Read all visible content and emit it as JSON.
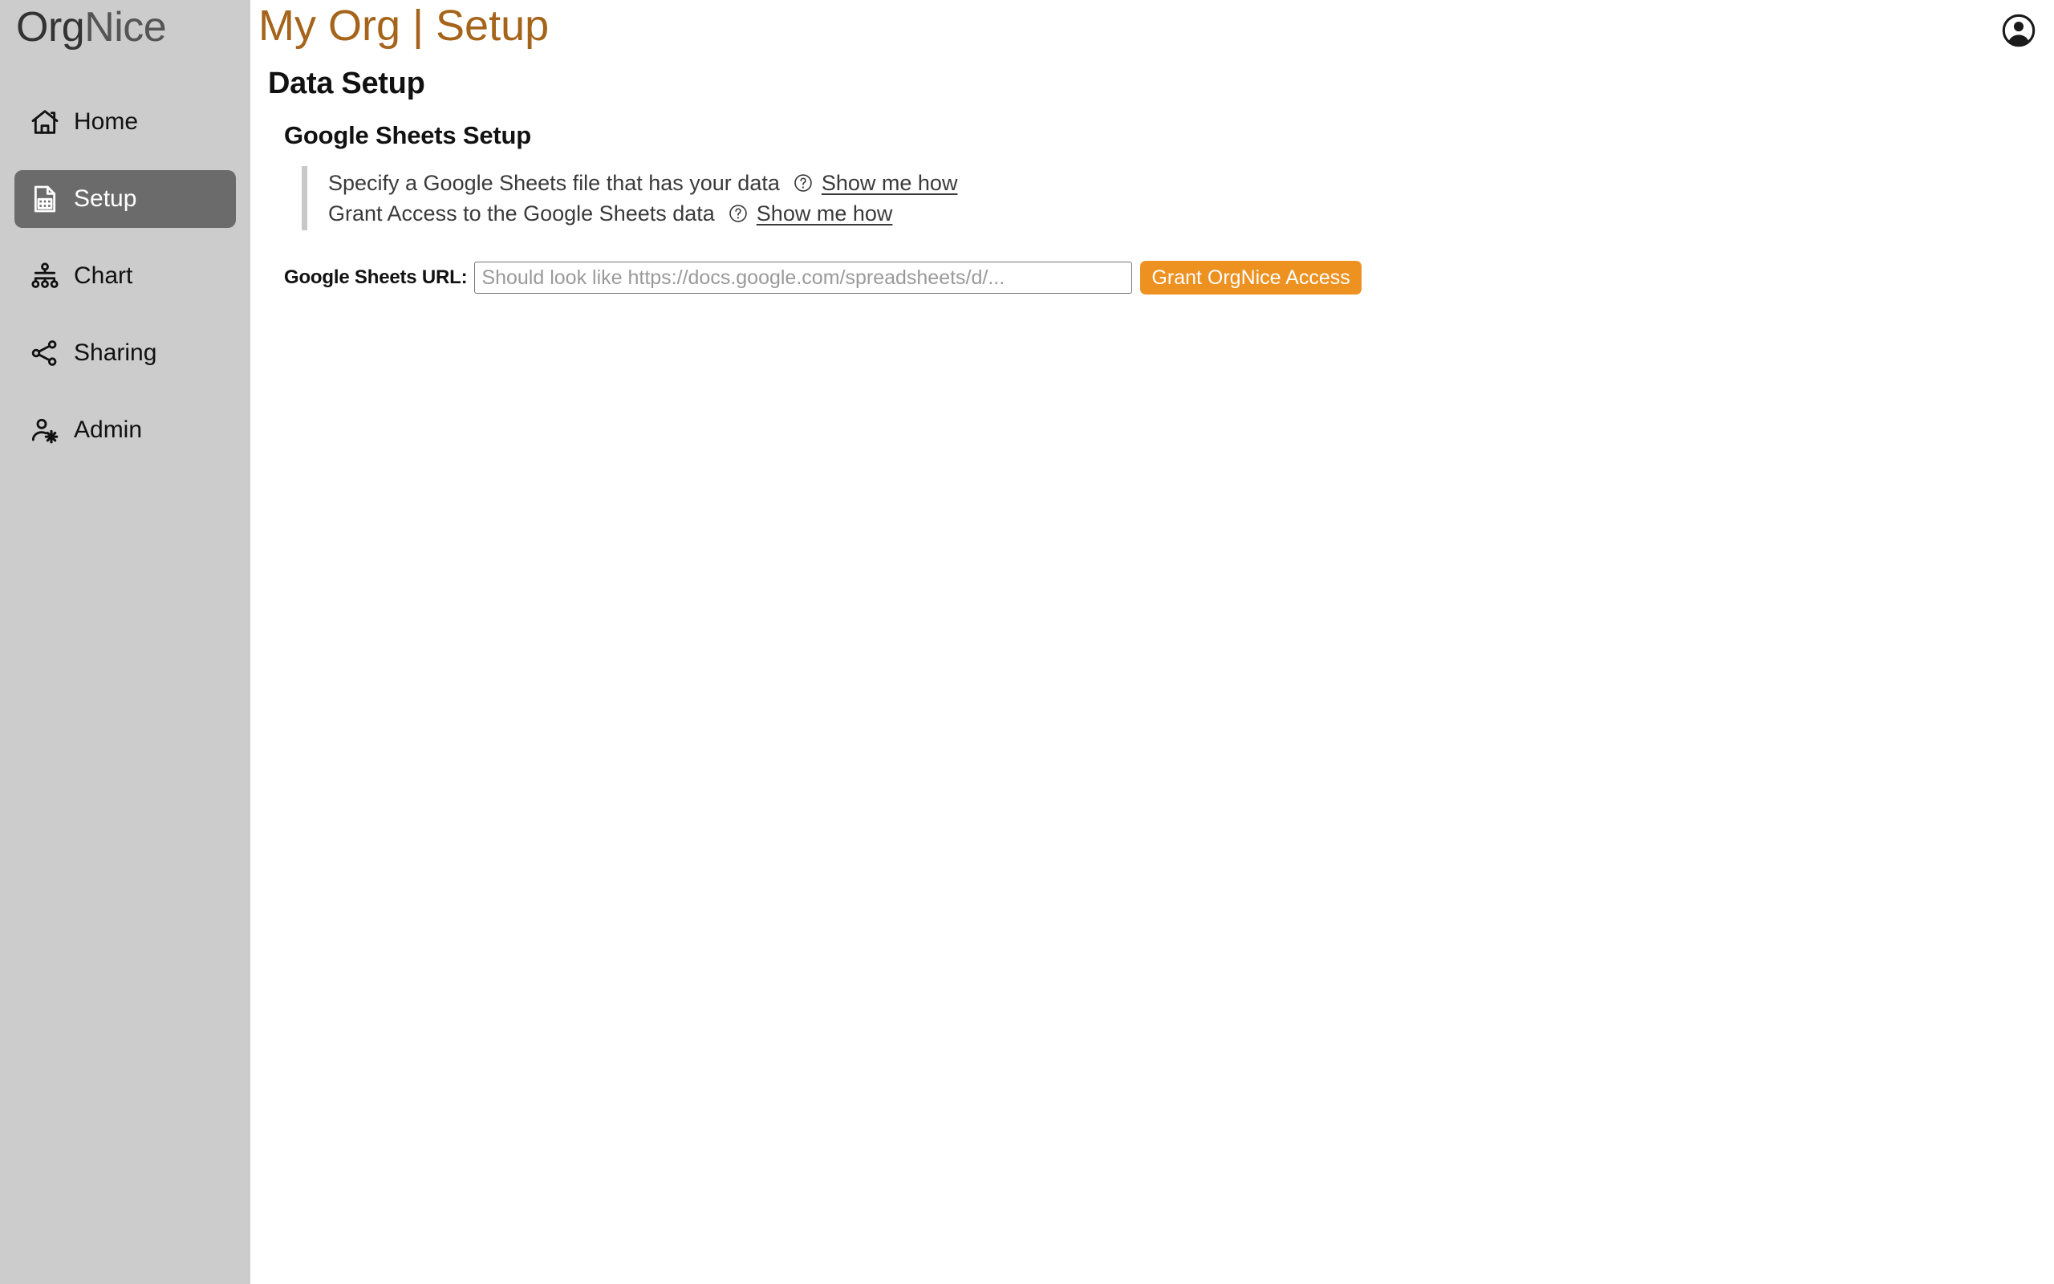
{
  "brand": {
    "part_one": "Org",
    "part_two": "Nice"
  },
  "sidebar": {
    "items": [
      {
        "label": "Home",
        "icon": "home-icon",
        "active": false
      },
      {
        "label": "Setup",
        "icon": "spreadsheet-icon",
        "active": true
      },
      {
        "label": "Chart",
        "icon": "org-chart-icon",
        "active": false
      },
      {
        "label": "Sharing",
        "icon": "share-icon",
        "active": false
      },
      {
        "label": "Admin",
        "icon": "person-gear-icon",
        "active": false
      }
    ]
  },
  "header": {
    "title": "My Org | Setup",
    "account_icon": "account-circle-icon",
    "title_color": "#a5641a"
  },
  "main": {
    "section_title": "Data Setup",
    "subsection_title": "Google Sheets Setup",
    "instructions": [
      {
        "text": "Specify a Google Sheets file that has your data",
        "help_icon": "question-circle-icon",
        "link_label": "Show me how"
      },
      {
        "text": "Grant Access to the Google Sheets data",
        "help_icon": "question-circle-icon",
        "link_label": "Show me how"
      }
    ],
    "url_field": {
      "label": "Google Sheets URL:",
      "value": "",
      "placeholder": "Should look like https://docs.google.com/spreadsheets/d/..."
    },
    "grant_button": {
      "label": "Grant OrgNice Access",
      "color": "#ed9121"
    }
  }
}
